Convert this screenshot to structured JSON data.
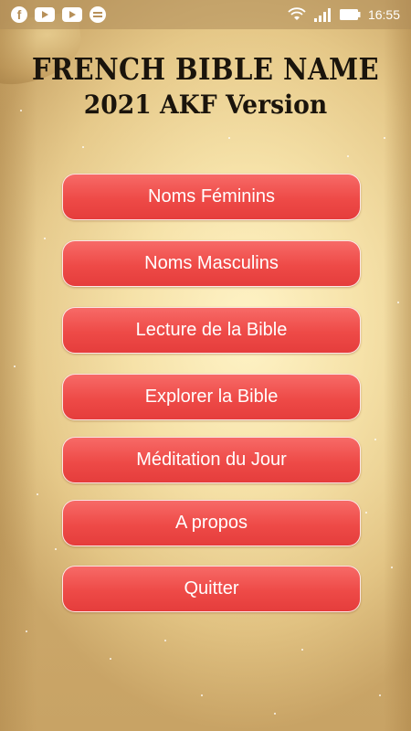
{
  "status_bar": {
    "icons_left": [
      "facebook-icon",
      "youtube-icon",
      "youtube-icon",
      "message-icon"
    ],
    "icons_right": [
      "wifi-icon",
      "signal-icon",
      "battery-icon"
    ],
    "time": "16:55"
  },
  "header": {
    "title_line1": "FRENCH BIBLE NAME",
    "title_line2": "2021 AKF Version"
  },
  "menu": {
    "items": [
      {
        "label": "Noms Féminins"
      },
      {
        "label": "Noms Masculins"
      },
      {
        "label": "Lecture de la Bible"
      },
      {
        "label": "Explorer la Bible"
      },
      {
        "label": "Méditation du Jour"
      },
      {
        "label": "A propos"
      },
      {
        "label": "Quitter"
      }
    ]
  },
  "colors": {
    "button": "#ee4a47",
    "button_text": "#ffffff",
    "title_text": "#1a140c",
    "parchment": "#f7e6b4"
  }
}
